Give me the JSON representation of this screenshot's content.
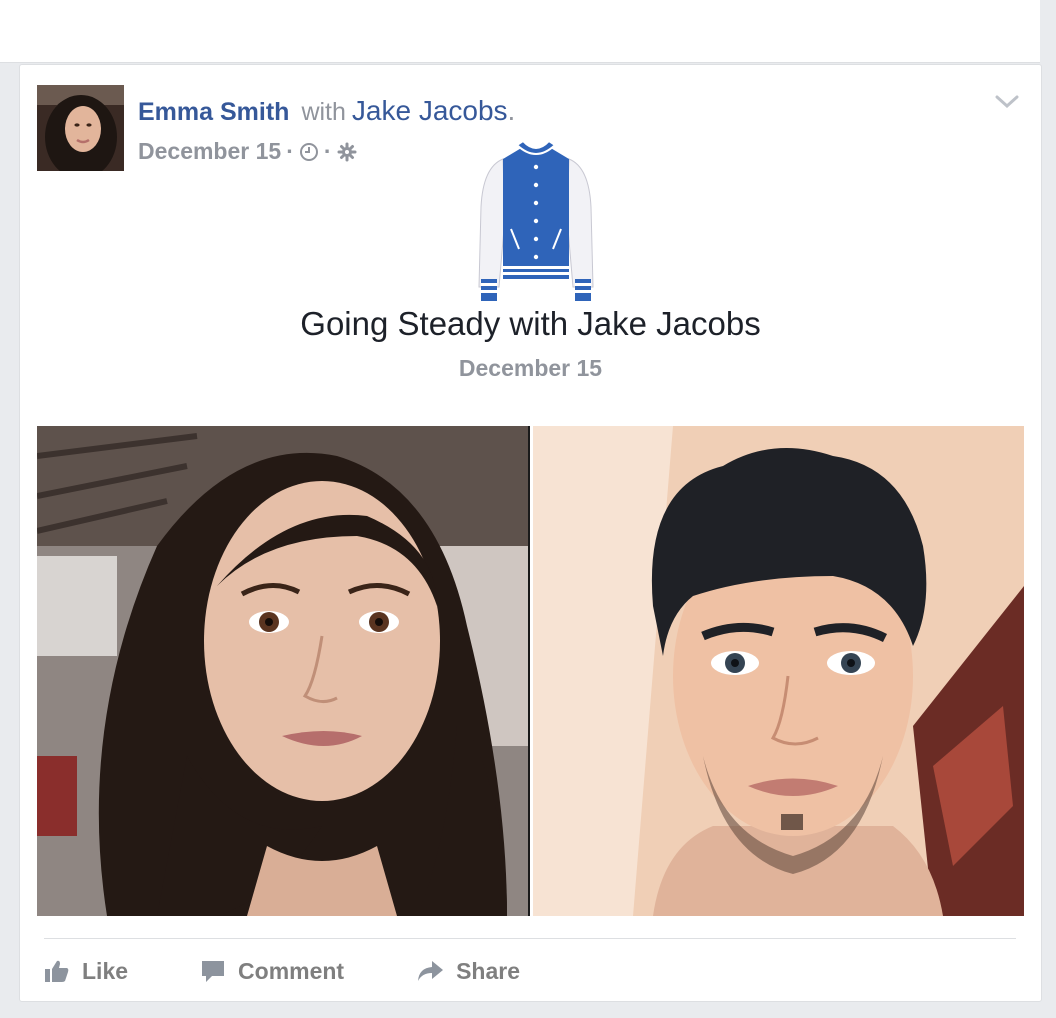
{
  "post": {
    "author": "Emma Smith",
    "with_text": "with",
    "tagged_person": "Jake Jacobs",
    "tagged_suffix": ".",
    "date": "December 15",
    "meta_separator": "·",
    "privacy_icon": "gear-icon",
    "time_icon": "clock-icon",
    "options_icon": "chevron-down-icon"
  },
  "event": {
    "icon": "varsity-jacket-icon",
    "title": "Going Steady with Jake Jacobs",
    "date": "December 15"
  },
  "photos": [
    {
      "subject": "woman-selfie"
    },
    {
      "subject": "man-selfie"
    }
  ],
  "actions": {
    "like": "Like",
    "comment": "Comment",
    "share": "Share"
  },
  "colors": {
    "link": "#365899",
    "muted": "#90949c",
    "action": "#7f7f7f",
    "jacket_blue": "#2f64b9"
  }
}
